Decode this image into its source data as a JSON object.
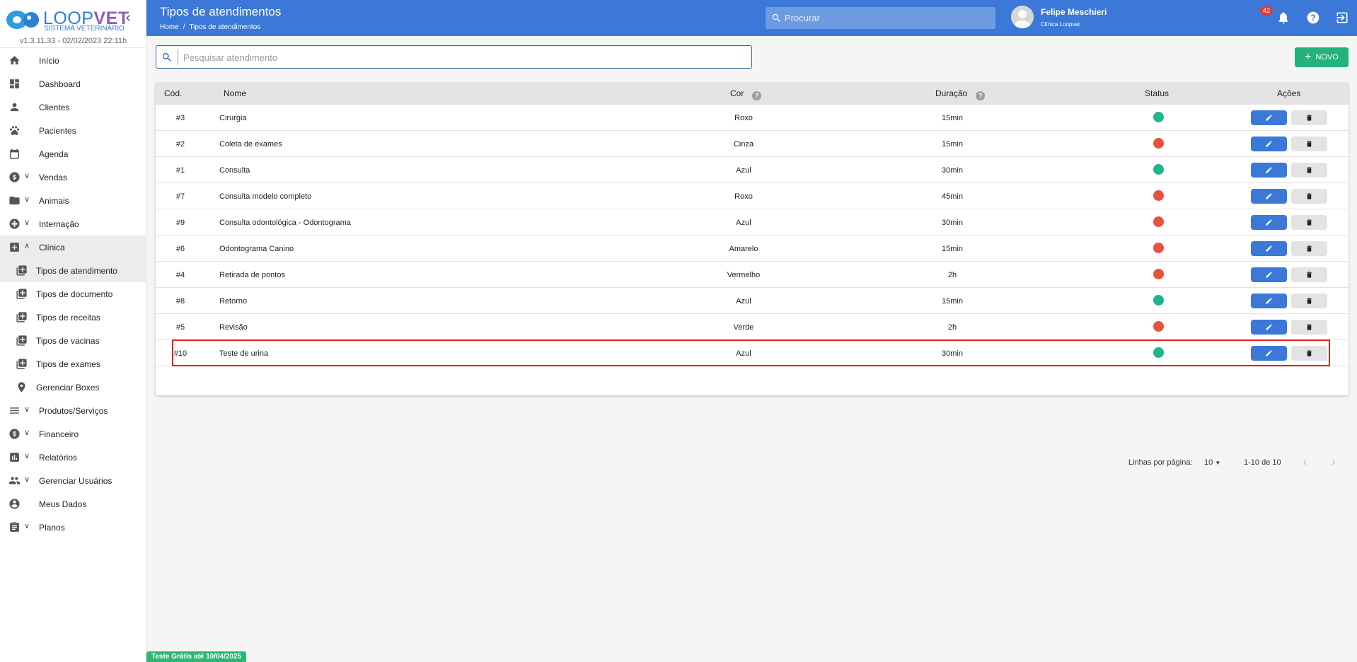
{
  "app": {
    "logo_loop": "LOOP",
    "logo_vet": "VET",
    "logo_sub": "SISTEMA VETERINÁRIO",
    "version": "v1.3.11.33 - 02/02/2023 22:11h",
    "trial": "Teste Grátis até 10/04/2025"
  },
  "sidebar": {
    "items": [
      {
        "label": "Início",
        "icon": "home-icon"
      },
      {
        "label": "Dashboard",
        "icon": "dashboard-icon"
      },
      {
        "label": "Clientes",
        "icon": "person-icon"
      },
      {
        "label": "Pacientes",
        "icon": "paw-icon"
      },
      {
        "label": "Agenda",
        "icon": "calendar-icon"
      },
      {
        "label": "Vendas",
        "icon": "dollar-icon"
      },
      {
        "label": "Animais",
        "icon": "folder-icon"
      },
      {
        "label": "Internação",
        "icon": "hospital-icon"
      },
      {
        "label": "Clínica",
        "icon": "clinic-icon"
      }
    ],
    "sub_items": [
      {
        "label": "Tipos de atendimento"
      },
      {
        "label": "Tipos de documento"
      },
      {
        "label": "Tipos de receitas"
      },
      {
        "label": "Tipos de vacinas"
      },
      {
        "label": "Tipos de exames"
      },
      {
        "label": "Gerenciar Boxes"
      }
    ],
    "items_after": [
      {
        "label": "Produtos/Serviços",
        "icon": "list-icon"
      },
      {
        "label": "Financeiro",
        "icon": "dollar-icon"
      },
      {
        "label": "Relatórios",
        "icon": "chart-icon"
      },
      {
        "label": "Gerenciar Usuários",
        "icon": "group-icon"
      },
      {
        "label": "Meus Dados",
        "icon": "account-icon"
      },
      {
        "label": "Planos",
        "icon": "clipboard-icon"
      }
    ]
  },
  "header": {
    "title": "Tipos de atendimentos",
    "breadcrumb_home": "Home",
    "breadcrumb_sep": "/",
    "breadcrumb_current": "Tipos de atendimentos",
    "search_placeholder": "Procurar",
    "user_name": "Felipe Meschieri",
    "user_clinic": "Clínica Loopvet",
    "notification_count": "42"
  },
  "main": {
    "search_placeholder": "Pesquisar atendimento",
    "new_button": "NOVO",
    "columns": {
      "code": "Cód.",
      "name": "Nome",
      "color": "Cor",
      "duration": "Duração",
      "status": "Status",
      "actions": "Ações"
    },
    "rows": [
      {
        "code": "#3",
        "name": "Cirurgia",
        "color": "Roxo",
        "duration": "15min",
        "status": "active"
      },
      {
        "code": "#2",
        "name": "Coleta de exames",
        "color": "Cinza",
        "duration": "15min",
        "status": "inactive"
      },
      {
        "code": "#1",
        "name": "Consulta",
        "color": "Azul",
        "duration": "30min",
        "status": "active"
      },
      {
        "code": "#7",
        "name": "Consulta modelo completo",
        "color": "Roxo",
        "duration": "45min",
        "status": "inactive"
      },
      {
        "code": "#9",
        "name": "Consulta odontológica - Odontograma",
        "color": "Azul",
        "duration": "30min",
        "status": "inactive"
      },
      {
        "code": "#6",
        "name": "Odontograma Canino",
        "color": "Amarelo",
        "duration": "15min",
        "status": "inactive"
      },
      {
        "code": "#4",
        "name": "Retirada de pontos",
        "color": "Vermelho",
        "duration": "2h",
        "status": "inactive"
      },
      {
        "code": "#8",
        "name": "Retorno",
        "color": "Azul",
        "duration": "15min",
        "status": "active"
      },
      {
        "code": "#5",
        "name": "Revisão",
        "color": "Verde",
        "duration": "2h",
        "status": "inactive"
      },
      {
        "code": "#10",
        "name": "Teste de urina",
        "color": "Azul",
        "duration": "30min",
        "status": "active"
      }
    ],
    "pagination": {
      "rows_per_page_label": "Linhas por página:",
      "rows_per_page": "10",
      "range": "1-10 de 10"
    }
  },
  "colors": {
    "primary": "#3b78d8",
    "status_active": "#1fb58a",
    "status_inactive": "#e8513b",
    "new_button": "#21b37a",
    "highlight": "#e02020"
  }
}
